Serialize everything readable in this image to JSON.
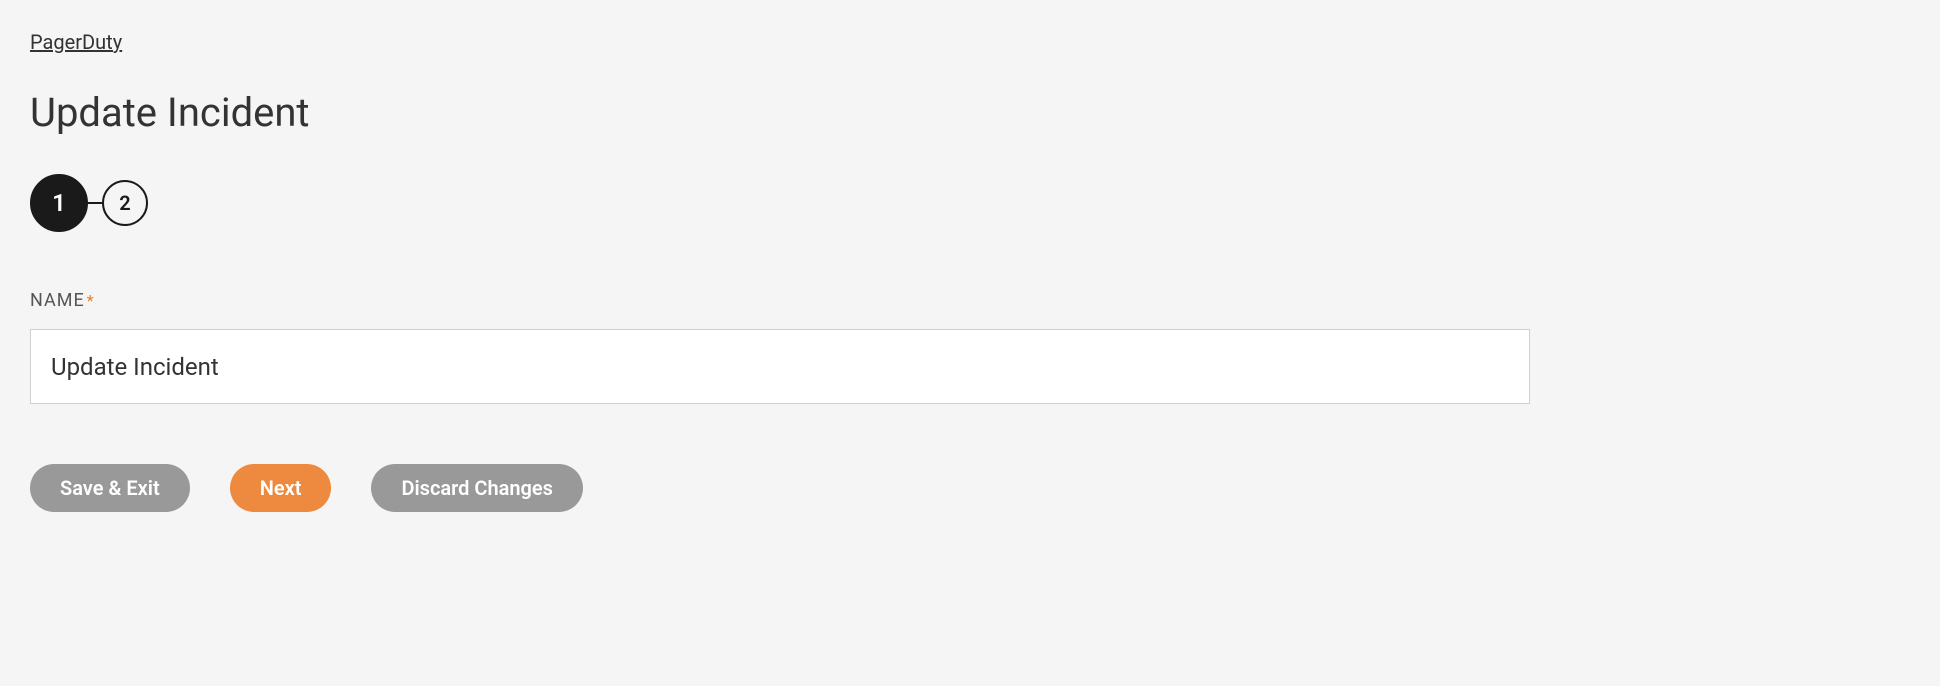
{
  "breadcrumb": {
    "label": "PagerDuty"
  },
  "page": {
    "title": "Update Incident"
  },
  "stepper": {
    "steps": [
      {
        "number": "1",
        "active": true
      },
      {
        "number": "2",
        "active": false
      }
    ]
  },
  "form": {
    "name_field": {
      "label": "NAME",
      "required_marker": "*",
      "value": "Update Incident"
    }
  },
  "buttons": {
    "save_exit": "Save & Exit",
    "next": "Next",
    "discard": "Discard Changes"
  }
}
